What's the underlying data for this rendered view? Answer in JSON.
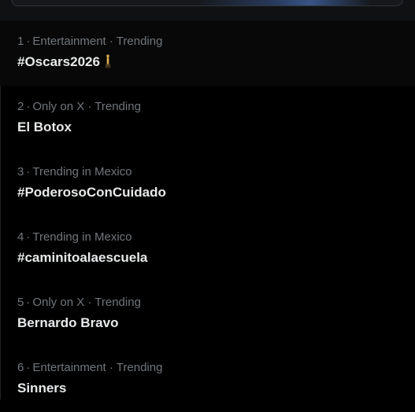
{
  "trends": [
    {
      "rank": "1",
      "sep": "·",
      "context": "Entertainment · Trending",
      "name": "#Oscars2026",
      "icon": "oscar-statuette-icon"
    },
    {
      "rank": "2",
      "sep": "·",
      "context": "Only on X · Trending",
      "name": "El Botox"
    },
    {
      "rank": "3",
      "sep": "·",
      "context": "Trending in Mexico",
      "name": "#PoderosoConCuidado"
    },
    {
      "rank": "4",
      "sep": "·",
      "context": "Trending in Mexico",
      "name": "#caminitoalaescuela"
    },
    {
      "rank": "5",
      "sep": "·",
      "context": "Only on X · Trending",
      "name": "Bernardo Bravo"
    },
    {
      "rank": "6",
      "sep": "·",
      "context": "Entertainment · Trending",
      "name": "Sinners"
    }
  ],
  "colors": {
    "background": "#000000",
    "text_primary": "#e7e9ea",
    "text_secondary": "#71767b",
    "hover_row": "#080808"
  }
}
